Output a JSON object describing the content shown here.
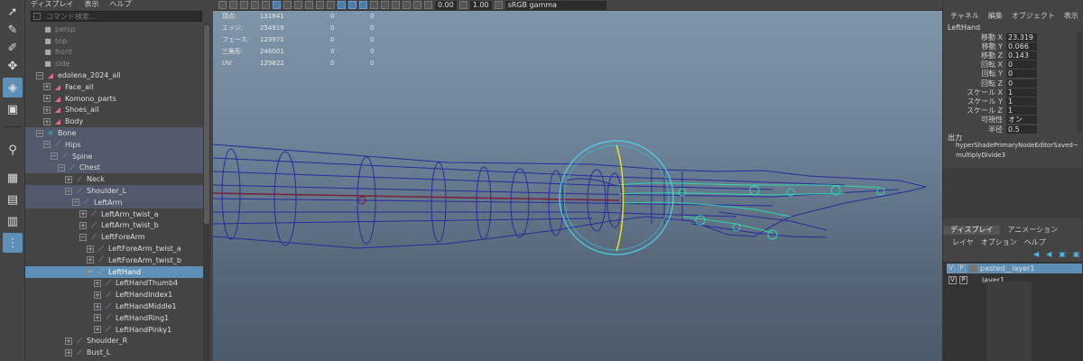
{
  "outliner": {
    "menu": [
      "ディスプレイ",
      "表示",
      "ヘルプ"
    ],
    "search_placeholder": "コマンド検索...",
    "items": [
      {
        "label": "persp",
        "icon": "camera-icon",
        "dim": true
      },
      {
        "label": "top",
        "icon": "camera-icon",
        "dim": true
      },
      {
        "label": "front",
        "icon": "camera-icon",
        "dim": true
      },
      {
        "label": "side",
        "icon": "camera-icon",
        "dim": true
      },
      {
        "label": "edolena_2024_all",
        "icon": "group-icon",
        "exp": "−"
      },
      {
        "label": "Face_all",
        "icon": "group-icon",
        "exp": "+"
      },
      {
        "label": "Komono_parts",
        "icon": "group-icon",
        "exp": "+"
      },
      {
        "label": "Shoes_all",
        "icon": "group-icon",
        "exp": "+"
      },
      {
        "label": "Body",
        "icon": "group-icon",
        "exp": "+"
      },
      {
        "label": "Bone",
        "icon": "bone-icon",
        "exp": "−"
      },
      {
        "label": "Hips",
        "icon": "joint-icon",
        "exp": "−"
      },
      {
        "label": "Spine",
        "icon": "joint-icon",
        "exp": "−"
      },
      {
        "label": "Chest",
        "icon": "joint-icon",
        "exp": "−"
      },
      {
        "label": "Neck",
        "icon": "joint-icon",
        "exp": "+"
      },
      {
        "label": "Shoulder_L",
        "icon": "joint-icon",
        "exp": "−"
      },
      {
        "label": "LeftArm",
        "icon": "joint-icon",
        "exp": "−"
      },
      {
        "label": "LeftArm_twist_a",
        "icon": "joint-icon",
        "exp": "+"
      },
      {
        "label": "LeftArm_twist_b",
        "icon": "joint-icon",
        "exp": "+"
      },
      {
        "label": "LeftForeArm",
        "icon": "joint-icon",
        "exp": "−"
      },
      {
        "label": "LeftForeArm_twist_a",
        "icon": "joint-icon",
        "exp": "+"
      },
      {
        "label": "LeftForeArm_twist_b",
        "icon": "joint-icon",
        "exp": "+"
      },
      {
        "label": "LeftHand",
        "icon": "joint-icon",
        "exp": "−"
      },
      {
        "label": "LeftHandThumb4",
        "icon": "joint-icon",
        "exp": "+"
      },
      {
        "label": "LeftHandIndex1",
        "icon": "joint-icon",
        "exp": "+"
      },
      {
        "label": "LeftHandMiddle1",
        "icon": "joint-icon",
        "exp": "+"
      },
      {
        "label": "LeftHandRing1",
        "icon": "joint-icon",
        "exp": "+"
      },
      {
        "label": "LeftHandPinky1",
        "icon": "joint-icon",
        "exp": "+"
      },
      {
        "label": "Shoulder_R",
        "icon": "joint-icon",
        "exp": "+"
      },
      {
        "label": "Bust_L",
        "icon": "joint-icon",
        "exp": "+"
      },
      {
        "label": "Bust_R",
        "icon": "joint-icon",
        "exp": "+"
      }
    ],
    "highlighted": [
      "Bone",
      "Hips",
      "Spine",
      "Chest",
      "Shoulder_L",
      "LeftArm"
    ],
    "selected": "LeftHand"
  },
  "viewport": {
    "toolbar": {
      "exposure": "0.00",
      "gamma": "1.00",
      "color_space": "sRGB gamma"
    },
    "hud": [
      {
        "label": "頂点:",
        "v1": "131841",
        "v2": "0",
        "v3": "0"
      },
      {
        "label": "エッジ:",
        "v1": "254919",
        "v2": "0",
        "v3": "0"
      },
      {
        "label": "フェース:",
        "v1": "123971",
        "v2": "0",
        "v3": "0"
      },
      {
        "label": "三角形:",
        "v1": "246001",
        "v2": "0",
        "v3": "0"
      },
      {
        "label": "UV:",
        "v1": "129822",
        "v2": "0",
        "v3": "0"
      }
    ]
  },
  "channel_box": {
    "menu": [
      "チャネル",
      "編集",
      "オブジェクト",
      "表示"
    ],
    "object_name": "LeftHand",
    "attrs": [
      {
        "name": "移動 X",
        "value": "23.319"
      },
      {
        "name": "移動 Y",
        "value": "0.066"
      },
      {
        "name": "移動 Z",
        "value": "0.143"
      },
      {
        "name": "回転 X",
        "value": "0"
      },
      {
        "name": "回転 Y",
        "value": "0"
      },
      {
        "name": "回転 Z",
        "value": "0"
      },
      {
        "name": "スケール X",
        "value": "1"
      },
      {
        "name": "スケール Y",
        "value": "1"
      },
      {
        "name": "スケール Z",
        "value": "1"
      },
      {
        "name": "可視性",
        "value": "オン"
      },
      {
        "name": "半径",
        "value": "0.5"
      }
    ],
    "outputs_label": "出力",
    "outputs": [
      "hyperShadePrimaryNodeEditorSaved~",
      "multiplyDivide3"
    ]
  },
  "layers": {
    "tabs": [
      "ディスプレイ",
      "アニメーション"
    ],
    "menu": [
      "レイヤ",
      "オプション",
      "ヘルプ"
    ],
    "items": [
      {
        "v": "V",
        "p": "P",
        "name": "pasted__layer1",
        "selected": true
      },
      {
        "v": "V",
        "p": "P",
        "name": "layer1",
        "selected": false
      }
    ]
  }
}
